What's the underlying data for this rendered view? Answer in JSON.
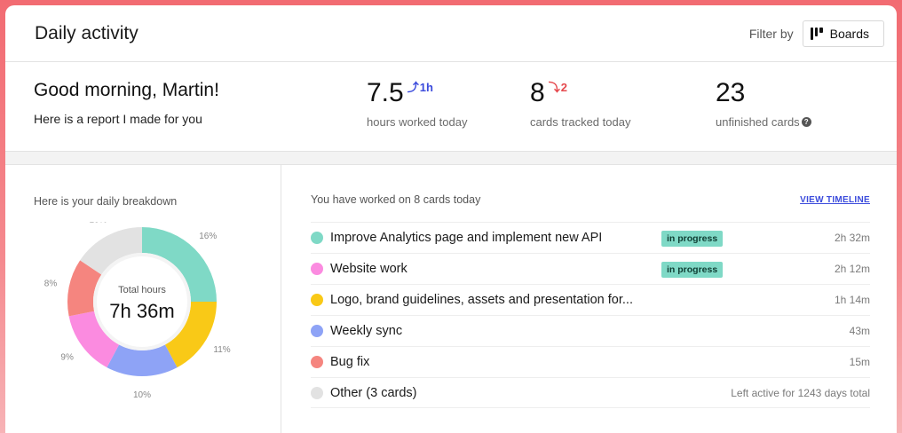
{
  "header": {
    "title": "Daily activity",
    "filter_label": "Filter by",
    "boards_label": "Boards"
  },
  "summary": {
    "greeting": "Good morning, Martin!",
    "subtitle": "Here is a report I made for you",
    "hours": {
      "value": "7.5",
      "delta": "1h",
      "delta_direction": "up",
      "label": "hours worked today"
    },
    "cards": {
      "value": "8",
      "delta": "2",
      "delta_direction": "down",
      "label": "cards tracked today"
    },
    "unfinished": {
      "value": "23",
      "label": "unfinished cards",
      "help": "?"
    }
  },
  "breakdown": {
    "title": "Here is your daily breakdown",
    "center_label": "Total hours",
    "center_value": "7h 36m"
  },
  "chart_data": {
    "type": "pie",
    "title": "",
    "categories": [
      "Improve Analytics page and implement new API",
      "Website work",
      "Logo, brand guidelines, assets and presentation for...",
      "Weekly sync",
      "Bug fix",
      "Other (3 cards)"
    ],
    "values": [
      16,
      11,
      10,
      9,
      8,
      10
    ],
    "labels": [
      "16%",
      "11%",
      "10%",
      "9%",
      "8%",
      "10%"
    ],
    "colors": [
      "#7fd9c6",
      "#f9c917",
      "#8ea3f6",
      "#fb8be0",
      "#f5857f",
      "#e2e2e2"
    ]
  },
  "cards_panel": {
    "subtitle": "You have worked on 8 cards today",
    "timeline_link": "VIEW TIMELINE",
    "items": [
      {
        "title": "Improve Analytics page and implement new API",
        "badge": "in progress",
        "time": "2h 32m",
        "color": "#7fd9c6"
      },
      {
        "title": "Website work",
        "badge": "in progress",
        "time": "2h 12m",
        "color": "#fb8be0"
      },
      {
        "title": "Logo, brand guidelines, assets and presentation for...",
        "badge": "",
        "time": "1h 14m",
        "color": "#f9c917"
      },
      {
        "title": "Weekly sync",
        "badge": "",
        "time": "43m",
        "color": "#8ea3f6"
      },
      {
        "title": "Bug fix",
        "badge": "",
        "time": "15m",
        "color": "#f5857f"
      },
      {
        "title": "Other (3 cards)",
        "badge": "",
        "time": "Left active for 1243 days total",
        "color": "#e2e2e2"
      }
    ]
  }
}
